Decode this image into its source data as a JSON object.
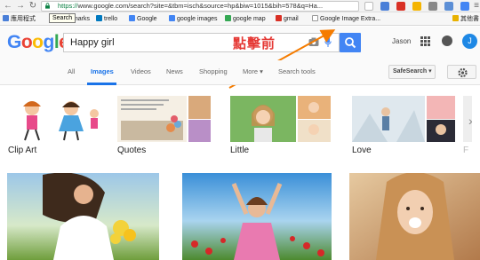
{
  "browser": {
    "url_scheme": "https://",
    "url_rest": "www.google.com/search?site=&tbm=isch&source=hp&biw=1015&bih=578&q=Ha...",
    "tooltip": "Search",
    "bookmarks": [
      {
        "label": "應用程式",
        "color": "#4a7fd8"
      },
      {
        "label": "Bookmarks",
        "color": "#e8b100"
      },
      {
        "label": "trello",
        "color": "#0079bf"
      },
      {
        "label": "Google",
        "color": "#4285f4"
      },
      {
        "label": "google images",
        "color": "#4285f4"
      },
      {
        "label": "google map",
        "color": "#34a853"
      },
      {
        "label": "gmail",
        "color": "#d93025"
      },
      {
        "label": "Google Image Extra...",
        "color": "#999999"
      }
    ],
    "bookmarks_overflow": "其他書"
  },
  "search": {
    "logo": "Google",
    "query": "Happy girl",
    "user": "Jason",
    "avatar_initial": "J"
  },
  "annotation": {
    "text": "點擊前",
    "color": "#e53935"
  },
  "tabs": [
    {
      "label": "All",
      "active": false
    },
    {
      "label": "Images",
      "active": true
    },
    {
      "label": "Videos",
      "active": false
    },
    {
      "label": "News",
      "active": false
    },
    {
      "label": "Shopping",
      "active": false
    },
    {
      "label": "More ▾",
      "active": false
    },
    {
      "label": "Search tools",
      "active": false
    }
  ],
  "safesearch_label": "SafeSearch ▾",
  "related": [
    {
      "label": "Clip Art"
    },
    {
      "label": "Quotes"
    },
    {
      "label": "Little"
    },
    {
      "label": "Love"
    },
    {
      "label": "F"
    }
  ],
  "colors": {
    "accent": "#4285f4",
    "active_tab": "#1a73e8"
  }
}
